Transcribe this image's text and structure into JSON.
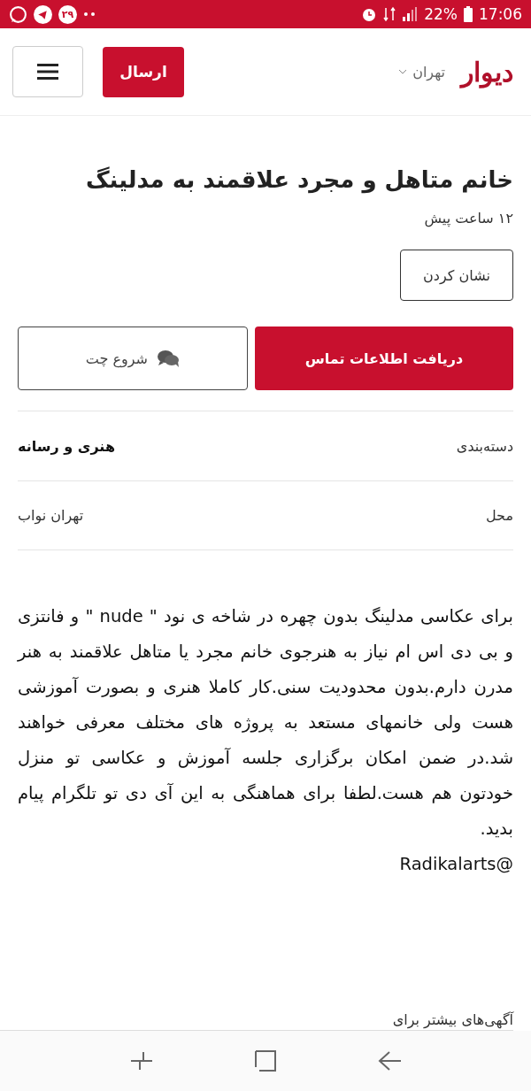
{
  "status_bar": {
    "notification_badge": "۲۹",
    "battery": "22%",
    "time": "17:06"
  },
  "header": {
    "logo": "دیوار",
    "city": "تهران",
    "post_button": "ارسال"
  },
  "ad": {
    "title": "خانم متاهل و مجرد علاقمند به مدلینگ",
    "posted": "۱۲ ساعت پیش",
    "bookmark_button": "نشان کردن",
    "contact_button": "دریافت اطلاعات تماس",
    "chat_button": "شروع چت",
    "details": [
      {
        "label": "دسته‌بندی",
        "value": "هنری و رسانه",
        "bold": true
      },
      {
        "label": "محل",
        "value": "تهران نواب",
        "bold": false
      }
    ],
    "description": "برای عکاسی مدلینگ بدون چهره در شاخه ی نود \" nude \" و فانتزی و بی دی اس ام نیاز به هنرجوی خانم مجرد یا متاهل علاقمند به هنر مدرن دارم.بدون محدودیت سنی.کار کاملا هنری و بصورت آموزشی هست ولی خانمهای مستعد به پروژه های مختلف معرفی خواهند شد.در ضمن امکان برگزاری جلسه آموزش و عکاسی تو منزل خودتون هم هست.لطفا برای هماهنگی به این آی دی تو تلگرام پیام بدید.",
    "contact_id": "@Radikalarts",
    "more_ads": "آگهی‌های بیشتر برای"
  }
}
